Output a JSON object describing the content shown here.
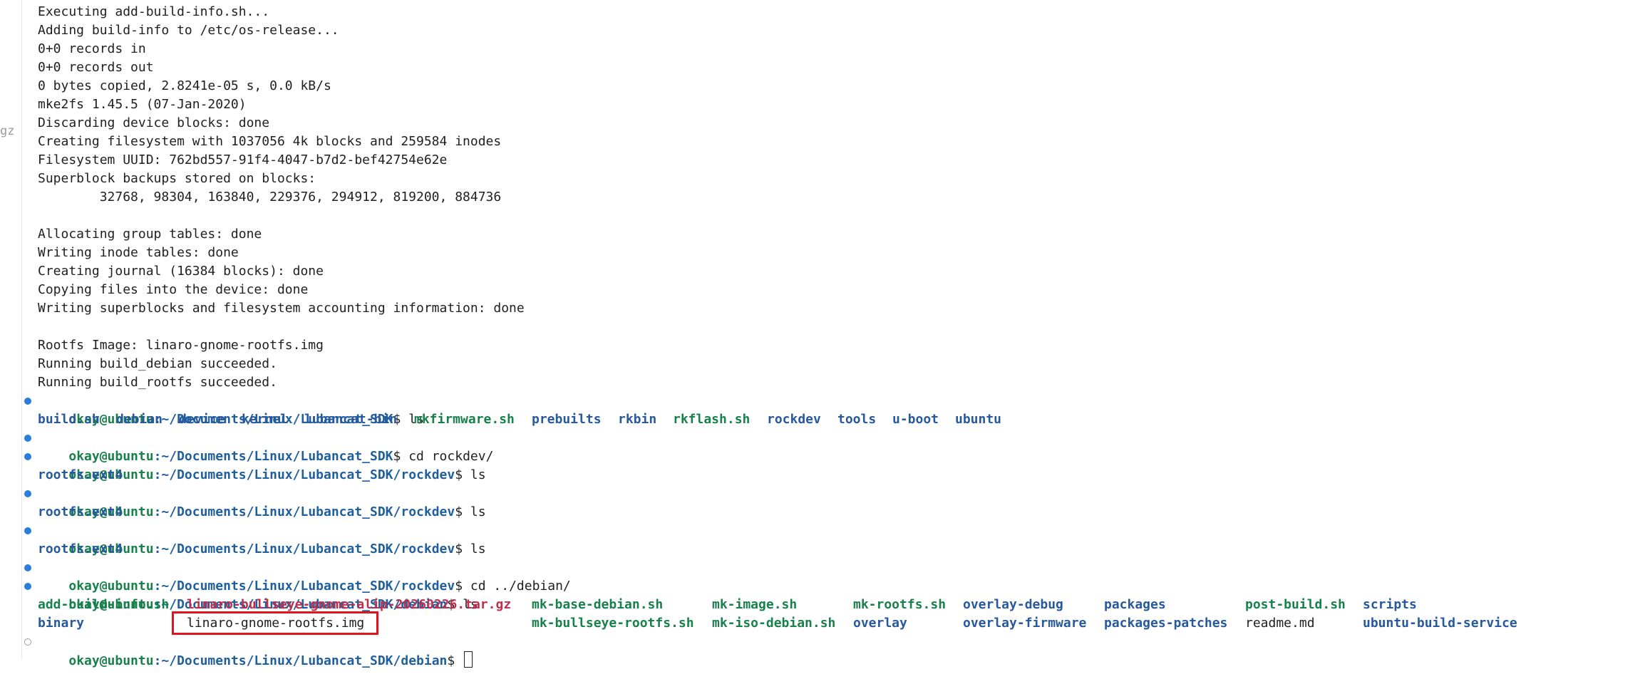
{
  "gutter_text": "gz",
  "output_lines": [
    "Executing add-build-info.sh...",
    "Adding build-info to /etc/os-release...",
    "0+0 records in",
    "0+0 records out",
    "0 bytes copied, 2.8241e-05 s, 0.0 kB/s",
    "mke2fs 1.45.5 (07-Jan-2020)",
    "Discarding device blocks: done",
    "Creating filesystem with 1037056 4k blocks and 259584 inodes",
    "Filesystem UUID: 762bd557-91f4-4047-b7d2-bef42754e62e",
    "Superblock backups stored on blocks:",
    "        32768, 98304, 163840, 229376, 294912, 819200, 884736",
    "",
    "Allocating group tables: done",
    "Writing inode tables: done",
    "Creating journal (16384 blocks): done",
    "Copying files into the device: done",
    "Writing superblocks and filesystem accounting information: done",
    "",
    "Rootfs Image: linaro-gnome-rootfs.img",
    "Running build_debian succeeded.",
    "Running build_rootfs succeeded."
  ],
  "prompt_user": "okay@ubuntu",
  "paths": {
    "sdk": ":~/Documents/Linux/Lubancat_SDK",
    "rockdev": ":~/Documents/Linux/Lubancat_SDK/rockdev",
    "debian": ":~/Documents/Linux/Lubancat_SDK/debian"
  },
  "sdk_ls": [
    "build.sh",
    "debian",
    "device",
    "kernel",
    "lubancat-bin",
    "mkfirmware.sh",
    "prebuilts",
    "rkbin",
    "rkflash.sh",
    "rockdev",
    "tools",
    "u-boot",
    "ubuntu"
  ],
  "commands": {
    "c1": "$ ls",
    "c2": "$ cd rockdev/",
    "c3": "$ ls",
    "c4": "$ ls",
    "c5": "$ ls",
    "c6": "$ cd ../debian/",
    "c7": "$ ls",
    "c8": "$ "
  },
  "rockdev_ls": "rootfs.ext4",
  "debian_ls_row1": [
    "add-build-info.sh",
    "linaro-bullseye-gnome-alip-20260226.tar.gz",
    "mk-base-debian.sh",
    "mk-image.sh",
    "mk-rootfs.sh",
    "overlay-debug",
    "packages",
    "post-build.sh",
    "scripts"
  ],
  "debian_ls_row2": [
    "binary",
    "linaro-gnome-rootfs.img",
    "mk-bullseye-rootfs.sh",
    "mk-iso-debian.sh",
    "overlay",
    "overlay-firmware",
    "packages-patches",
    "readme.md",
    "ubuntu-build-service"
  ],
  "colors": {
    "prompt_user": "#18804b",
    "directory": "#27599d",
    "archive": "#c0304e",
    "highlight_box": "#e0141e",
    "decoration_dot": "#2a7dd8"
  }
}
